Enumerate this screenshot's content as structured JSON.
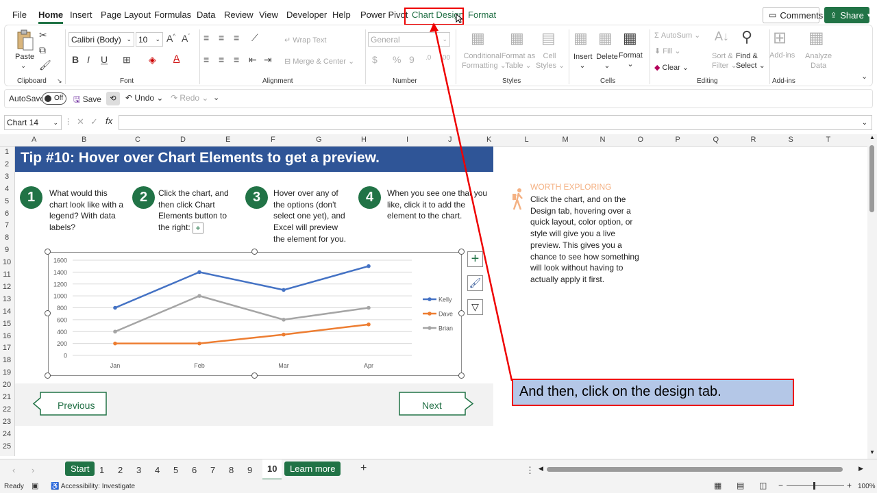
{
  "menu": {
    "tabs": [
      "File",
      "Home",
      "Insert",
      "Page Layout",
      "Formulas",
      "Data",
      "Review",
      "View",
      "Developer",
      "Help",
      "Power Pivot",
      "Chart Design",
      "Format"
    ],
    "comments": "Comments",
    "share": "Share"
  },
  "ribbon": {
    "clipboard": {
      "paste": "Paste",
      "label": "Clipboard"
    },
    "font": {
      "name": "Calibri (Body)",
      "size": "10",
      "label": "Font"
    },
    "alignment": {
      "wrap": "Wrap Text",
      "merge": "Merge & Center",
      "label": "Alignment"
    },
    "number": {
      "format": "General",
      "label": "Number"
    },
    "styles": {
      "conditional": [
        "Conditional",
        "Formatting"
      ],
      "format_as": [
        "Format as",
        "Table"
      ],
      "cell_styles": [
        "Cell",
        "Styles"
      ],
      "label": "Styles"
    },
    "cells": {
      "insert": "Insert",
      "delete": "Delete",
      "format": "Format",
      "label": "Cells"
    },
    "editing": {
      "autosum": "AutoSum",
      "fill": "Fill",
      "clear": "Clear",
      "sort": [
        "Sort &",
        "Filter"
      ],
      "find": [
        "Find &",
        "Select"
      ],
      "label": "Editing"
    },
    "addins": {
      "addins": "Add-ins",
      "analyze": [
        "Analyze",
        "Data"
      ],
      "label": "Add-ins"
    }
  },
  "qat": {
    "autosave": "AutoSave",
    "off": "Off",
    "save": "Save",
    "undo": "Undo",
    "redo": "Redo"
  },
  "formula_bar": {
    "name_box": "Chart 14",
    "fx": "fx",
    "value": ""
  },
  "grid": {
    "columns": [
      "A",
      "B",
      "C",
      "D",
      "E",
      "F",
      "G",
      "H",
      "I",
      "J",
      "K",
      "L",
      "M",
      "N",
      "O",
      "P",
      "Q",
      "R",
      "S",
      "T"
    ],
    "rows": [
      "1",
      "2",
      "3",
      "4",
      "5",
      "6",
      "7",
      "8",
      "9",
      "10",
      "11",
      "12",
      "13",
      "14",
      "15",
      "16",
      "17",
      "18",
      "19",
      "20",
      "21",
      "22",
      "23",
      "24",
      "25"
    ]
  },
  "content": {
    "tip_title": "Tip #10: Hover over Chart Elements to get a preview.",
    "steps": [
      {
        "num": "1",
        "lines": [
          "What would this",
          "chart look like with a",
          "legend? With data",
          "labels?"
        ]
      },
      {
        "num": "2",
        "lines": [
          "Click the chart, and",
          "then click Chart",
          "Elements button to",
          "the right:"
        ]
      },
      {
        "num": "3",
        "lines": [
          "Hover over any of",
          "the options (don't",
          "select one yet), and",
          "Excel will preview",
          "the element for you."
        ]
      },
      {
        "num": "4",
        "lines": [
          "When you see one that you",
          "like, click it to add the",
          "element to the chart."
        ]
      }
    ],
    "worth": {
      "heading": "WORTH EXPLORING",
      "lines": [
        "Click the chart, and on the",
        "Design tab, hovering over a",
        "quick layout, color option, or",
        "style will give you a live",
        "preview. This gives you a",
        "chance to see how something",
        "will look without having to",
        "actually apply it first."
      ]
    },
    "nav": {
      "previous": "Previous",
      "next": "Next"
    }
  },
  "callout": "And then, click on the design tab.",
  "chart_data": {
    "type": "line",
    "categories": [
      "Jan",
      "Feb",
      "Mar",
      "Apr"
    ],
    "series": [
      {
        "name": "Kelly",
        "color": "#4472c4",
        "values": [
          800,
          1400,
          1100,
          1500
        ]
      },
      {
        "name": "Dave",
        "color": "#ed7d31",
        "values": [
          200,
          200,
          350,
          520
        ]
      },
      {
        "name": "Brian",
        "color": "#a5a5a5",
        "values": [
          400,
          1000,
          600,
          800
        ]
      }
    ],
    "yticks": [
      "1600",
      "1400",
      "1200",
      "1000",
      "800",
      "600",
      "400",
      "200",
      "0"
    ],
    "ylim": [
      0,
      1600
    ],
    "grid": true,
    "legend": "right"
  },
  "sheets": {
    "start": "Start",
    "numbered": [
      "1",
      "2",
      "3",
      "4",
      "5",
      "6",
      "7",
      "8",
      "9",
      "10"
    ],
    "active": "10",
    "learn_more": "Learn more",
    "add": "+"
  },
  "status": {
    "ready": "Ready",
    "accessibility": "Accessibility: Investigate",
    "zoom": "100%"
  }
}
